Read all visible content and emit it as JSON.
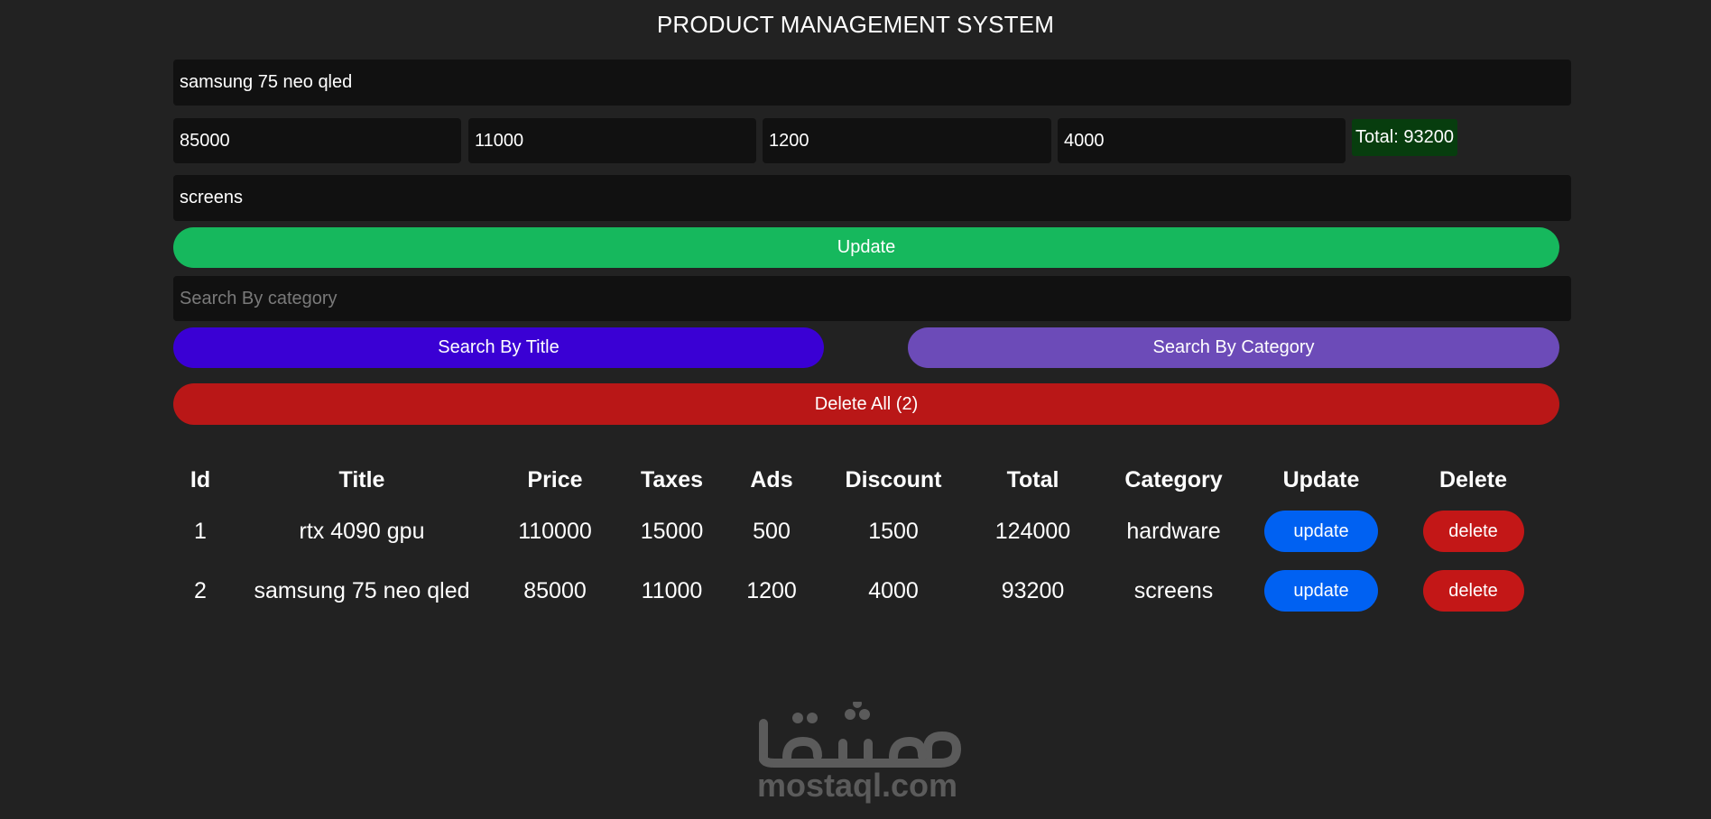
{
  "header": {
    "title": "PRODUCT MANAGEMENT SYSTEM"
  },
  "form": {
    "title_value": "samsung 75 neo qled",
    "price_value": "85000",
    "taxes_value": "11000",
    "ads_value": "1200",
    "discount_value": "4000",
    "total_label": "Total: 93200",
    "category_value": "screens",
    "submit_label": "Update",
    "search_placeholder": "Search By category",
    "search_title_label": "Search By Title",
    "search_category_label": "Search By Category",
    "delete_all_label": "Delete All (2)"
  },
  "table": {
    "headers": [
      "Id",
      "Title",
      "Price",
      "Taxes",
      "Ads",
      "Discount",
      "Total",
      "Category",
      "Update",
      "Delete"
    ],
    "rows": [
      {
        "id": "1",
        "title": "rtx 4090 gpu",
        "price": "110000",
        "taxes": "15000",
        "ads": "500",
        "discount": "1500",
        "total": "124000",
        "category": "hardware",
        "update_label": "update",
        "delete_label": "delete"
      },
      {
        "id": "2",
        "title": "samsung 75 neo qled",
        "price": "85000",
        "taxes": "11000",
        "ads": "1200",
        "discount": "4000",
        "total": "93200",
        "category": "screens",
        "update_label": "update",
        "delete_label": "delete"
      }
    ]
  },
  "watermark": {
    "domain": "mostaql.com"
  },
  "colors": {
    "background": "#222222",
    "input_bg": "#111111",
    "total_bg": "#073d0e",
    "update_green": "#16b85d",
    "search_title_blue": "#3a00d4",
    "search_category_purple": "#6c4bb8",
    "delete_red": "#b91717",
    "row_update_blue": "#0061f2"
  }
}
